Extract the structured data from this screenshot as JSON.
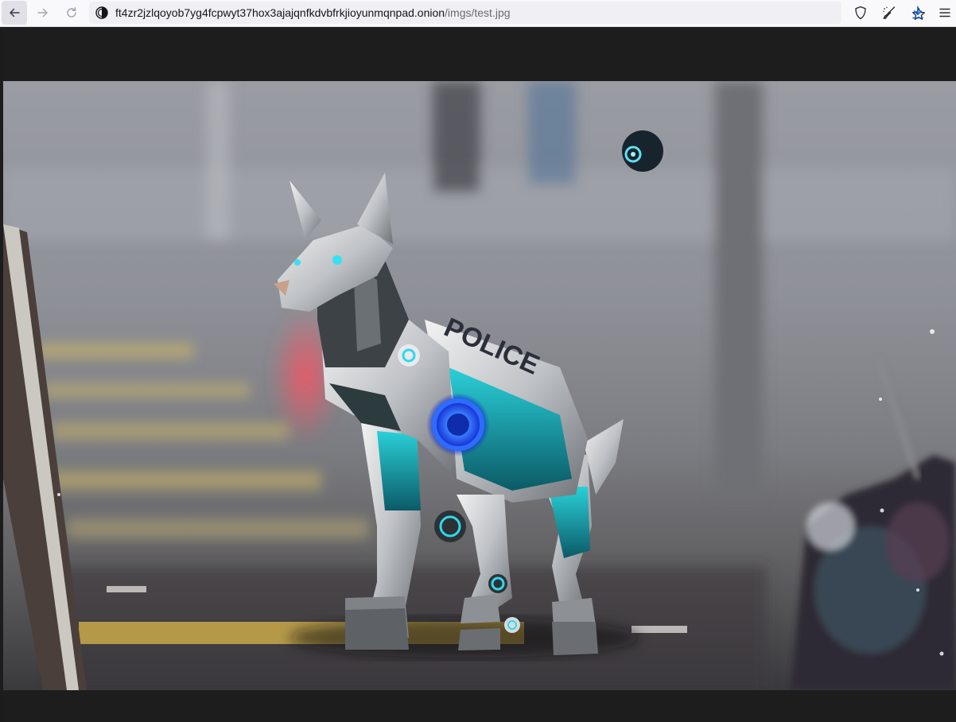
{
  "browser": {
    "url_host": "ft4zr2jzlqoyob7yg4fcpwyt37hox3ajajqnfkdvbfrkjioyunmqnpad.onion",
    "url_path": "/imgs/test.jpg",
    "icons": {
      "back": "arrow-left-icon",
      "forward": "arrow-right-icon",
      "reload": "reload-icon",
      "site": "onion-site-icon",
      "bookmark": "star-icon",
      "shield": "shield-icon",
      "tor_circuit": "broom-icon",
      "downloads": "download-icon",
      "menu": "hamburger-menu-icon"
    },
    "accent_color": "#0061e0"
  },
  "image": {
    "subject": "robotic police dog"
  }
}
